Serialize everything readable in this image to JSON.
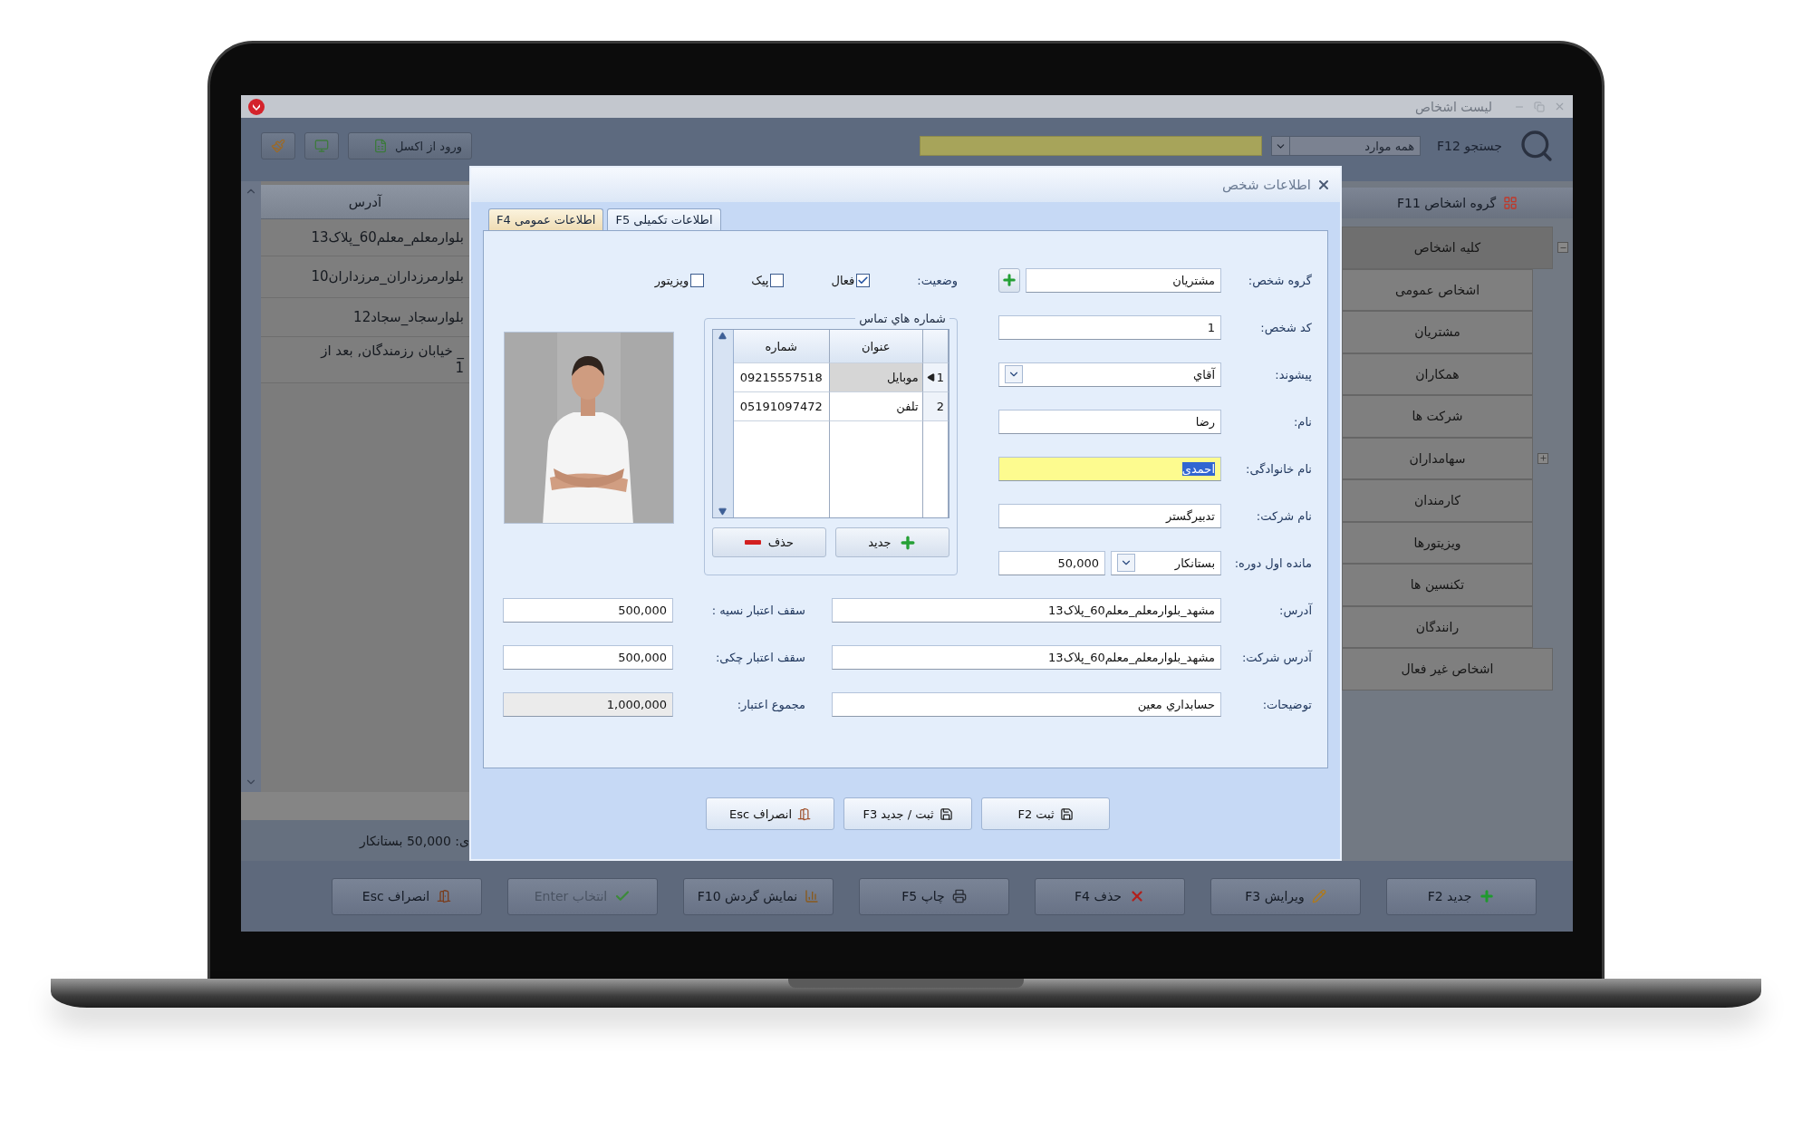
{
  "window": {
    "title": "لیست اشخاص"
  },
  "toolbar": {
    "import_button": "ورود از اکسل",
    "search_label": "جستجو F12",
    "search_scope": "همه موارد"
  },
  "table": {
    "columns": [
      "آدرس"
    ],
    "rows": [
      [
        "بلوارمعلم_معلم60_پلاک13"
      ],
      [
        "بلوارمرزداران_مرزداران10"
      ],
      [
        "بلوارسجاد_سجاد12"
      ],
      [
        "_ خیابان رزمندگان, بعد از\n1"
      ]
    ]
  },
  "status_bar": "ی: 50,000 بستانکار",
  "sidebar": {
    "title": "گروه اشخاص F11",
    "tree": [
      {
        "label": "کلیه اشخاص",
        "selected": true,
        "expanded": true,
        "children": [
          {
            "label": "اشخاص عمومی",
            "selected": false
          },
          {
            "label": "مشتریان",
            "selected": false
          },
          {
            "label": "همکاران",
            "selected": false
          },
          {
            "label": "شرکت ها",
            "selected": false
          },
          {
            "label": "سهامداران",
            "selected": false,
            "expanded": false
          },
          {
            "label": "کارمندان",
            "selected": false
          },
          {
            "label": "ویزیتورها",
            "selected": false
          },
          {
            "label": "تکنسین ها",
            "selected": false
          },
          {
            "label": "رانندگان",
            "selected": false
          }
        ]
      },
      {
        "label": "اشخاص غیر فعال",
        "selected": false
      }
    ]
  },
  "bottom_buttons": [
    {
      "label": "جدید F2",
      "disabled": false
    },
    {
      "label": "ویرایش F3",
      "disabled": false
    },
    {
      "label": "حذف F4",
      "disabled": false
    },
    {
      "label": "چاپ F5",
      "disabled": false
    },
    {
      "label": "نمایش گردش F10",
      "disabled": false
    },
    {
      "label": "انتخاب Enter",
      "disabled": true
    },
    {
      "label": "انصراف Esc",
      "disabled": false
    }
  ],
  "dialog": {
    "title": "اطلاعات شخص",
    "tabs": [
      {
        "label": "اطلاعات تکمیلی F5",
        "selected": false
      },
      {
        "label": "اطلاعات عمومی F4",
        "selected": true
      }
    ],
    "fields": [
      {
        "kind": "add",
        "label": "گروه شخص:",
        "value": "مشتریان",
        "focused": false
      },
      {
        "kind": "text",
        "label": "کد شخص:",
        "value": "1",
        "focused": false
      },
      {
        "kind": "dropdown",
        "label": "پیشوند:",
        "value": "آقاي",
        "focused": false
      },
      {
        "kind": "text",
        "label": "نام:",
        "value": "رضا",
        "focused": false
      },
      {
        "kind": "text",
        "label": "نام خانوادگی:",
        "value": "احمدی",
        "focused": true
      },
      {
        "kind": "text",
        "label": "نام شرکت:",
        "value": "تدبیرگستر",
        "focused": false
      },
      {
        "kind": "balance",
        "label": "مانده اول دوره:",
        "value": "بستانکار",
        "amount": "50,000",
        "focused": false
      }
    ],
    "status": {
      "label": "وضعیت:",
      "options": [
        {
          "label": "فعال",
          "checked": true
        },
        {
          "label": "پیک",
          "checked": false
        },
        {
          "label": "ویزیتور",
          "checked": false
        }
      ]
    },
    "contacts": {
      "title": "شماره هاي تماس",
      "columns": [
        "عنوان",
        "شماره"
      ],
      "rows": [
        {
          "index": "1",
          "title": "موبایل",
          "number": "09215557518",
          "selected": true
        },
        {
          "index": "2",
          "title": "تلفن",
          "number": "05191097472",
          "selected": false
        }
      ],
      "buttons": [
        "جدید",
        "حذف"
      ]
    },
    "photo": {
      "kind": "picture"
    },
    "wide_rows": [
      {
        "label": "آدرس:",
        "value": "مشهد_بلوارمعلم_معلم60_پلاک13",
        "side_label": "سقف اعتبار نسیه :",
        "side_value": "500,000",
        "readonly": false
      },
      {
        "label": "آدرس شرکت:",
        "value": "مشهد_بلوارمعلم_معلم60_پلاک13",
        "side_label": "سقف اعتبار چکی:",
        "side_value": "500,000",
        "readonly": false
      },
      {
        "label": "توضیحات:",
        "value": "حسابداري معين",
        "side_label": "مجموع اعتبار:",
        "side_value": "1,000,000",
        "readonly": true
      }
    ],
    "buttons": [
      "ثبت F2",
      "ثبت / جدید F3",
      "انصراف Esc"
    ]
  }
}
